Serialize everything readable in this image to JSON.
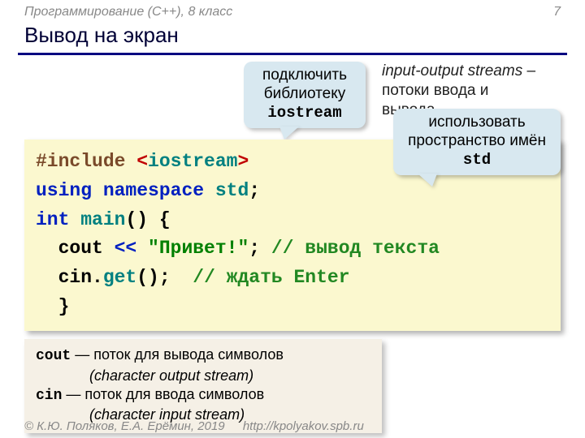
{
  "header": {
    "course": "Программирование (C++), 8 класс",
    "page": "7"
  },
  "title": "Вывод на экран",
  "callout1": {
    "l1": "подключить",
    "l2": "библиотеку",
    "l3": "iostream"
  },
  "note1": {
    "l1a": "input-output streams",
    "l1b": " –",
    "l2": "потоки ввода и",
    "l3": "вывода"
  },
  "code": {
    "l1a": "#include ",
    "l1b": "<",
    "l1c": "iostream",
    "l1d": ">",
    "l2a": "using ",
    "l2b": "namespace ",
    "l2c": "std",
    "l2d": ";",
    "l3a": "int ",
    "l3b": "main",
    "l3c": "() {",
    "l4a": "  cout ",
    "l4b": "<<",
    "l4c": " ",
    "l4d": "\"Привет!\"",
    "l4e": "; ",
    "l4f": "// вывод текста",
    "l5a": "  cin.",
    "l5b": "get",
    "l5c": "();  ",
    "l5d": "// ждать Enter",
    "l6": "  }"
  },
  "callout2": {
    "l1": "использовать",
    "l2": "пространство имён",
    "l3": "std"
  },
  "defs": {
    "d1a": "cout",
    "d1b": " — поток для вывода символов",
    "d1c": "(character output stream)",
    "d2a": "cin",
    "d2b": " — поток для ввода символов",
    "d2c": "(character input stream)"
  },
  "footer": {
    "copyright": "© К.Ю. Поляков, Е.А. Ерёмин, 2019",
    "url": "http://kpolyakov.spb.ru"
  }
}
